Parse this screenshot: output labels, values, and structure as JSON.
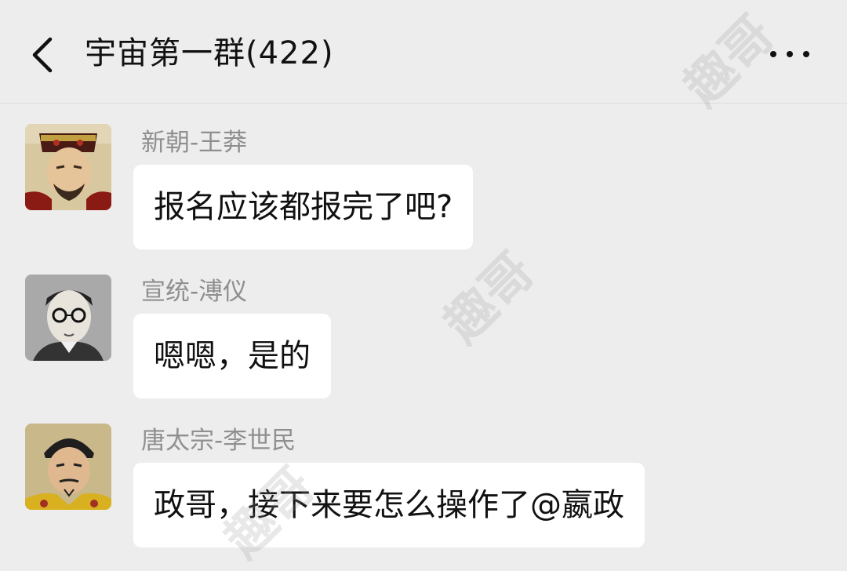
{
  "header": {
    "back_icon": "chevron-left-icon",
    "title": "宇宙第一群(422)",
    "more_icon": "more-dots-icon"
  },
  "messages": [
    {
      "sender": "新朝-王莽",
      "text": "报名应该都报完了吧?",
      "avatar": "portrait-wang-mang"
    },
    {
      "sender": "宣统-溥仪",
      "text": "嗯嗯，是的",
      "avatar": "portrait-puyi"
    },
    {
      "sender": "唐太宗-李世民",
      "text": "政哥，接下来要怎么操作了@嬴政",
      "avatar": "portrait-li-shimin"
    }
  ],
  "watermark": {
    "text": "趣哥"
  },
  "colors": {
    "background": "#ededed",
    "bubble": "#ffffff",
    "sender_text": "#8f8f8f",
    "text": "#111111"
  }
}
